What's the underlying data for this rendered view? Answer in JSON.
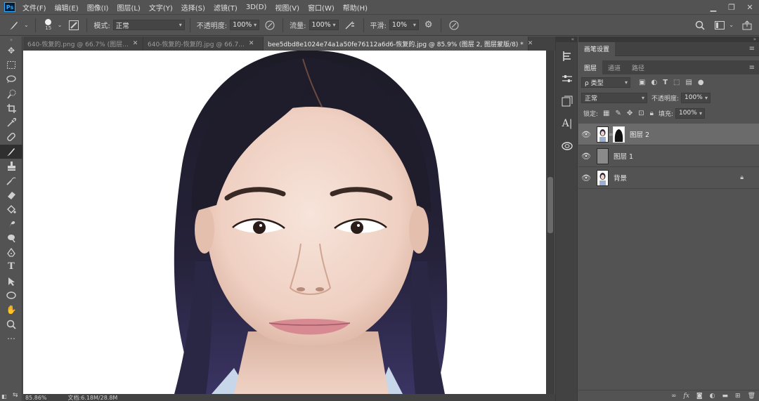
{
  "menu": {
    "logo": "Ps",
    "items": [
      "文件(F)",
      "编辑(E)",
      "图像(I)",
      "图层(L)",
      "文字(Y)",
      "选择(S)",
      "滤镜(T)",
      "3D(D)",
      "视图(V)",
      "窗口(W)",
      "帮助(H)"
    ],
    "window_buttons": [
      "▁",
      "❐",
      "✕"
    ]
  },
  "options": {
    "brush_size": "15",
    "mode_label": "模式:",
    "mode_value": "正常",
    "opacity_label": "不透明度:",
    "opacity_value": "100%",
    "flow_label": "流量:",
    "flow_value": "100%",
    "smoothing_label": "平滑:",
    "smoothing_value": "10%"
  },
  "tabs": [
    {
      "label": "640-恢复的.png @ 66.7% (图层...",
      "close": "✕"
    },
    {
      "label": "640-恢复的-恢复的.jpg @ 66.7...",
      "close": "✕"
    },
    {
      "label": "bee5dbd8e1024e74a1a50fe76112a6d6-恢复的.jpg @ 85.9% (图层 2, 图层蒙版/8) *",
      "close": "✕"
    }
  ],
  "status": {
    "zoom": "85.86%",
    "doc": "文档:6.18M/28.8M"
  },
  "brush_settings": {
    "tab": "画笔设置"
  },
  "layers_panel": {
    "tabs": [
      "图层",
      "通道",
      "路径"
    ],
    "filter_label": "ρ 类型",
    "blend_mode": "正常",
    "opacity_label": "不透明度:",
    "opacity_value": "100%",
    "lock_label": "锁定:",
    "fill_label": "填充:",
    "fill_value": "100%",
    "layers": [
      {
        "name": "图层 2",
        "selected": true,
        "has_mask": true
      },
      {
        "name": "图层 1",
        "selected": false,
        "has_mask": false
      },
      {
        "name": "背景",
        "selected": false,
        "locked": true
      }
    ],
    "footer_icons": [
      "link-icon",
      "fx-icon",
      "mask-icon",
      "adjustment-icon",
      "group-icon",
      "new-layer-icon",
      "delete-icon"
    ]
  },
  "colors": {
    "ui_bg": "#535353",
    "panel_dark": "#424242",
    "selected_layer": "#6b6b6b",
    "hair": "#1e1b2e",
    "skin": "#f3d9cc"
  }
}
